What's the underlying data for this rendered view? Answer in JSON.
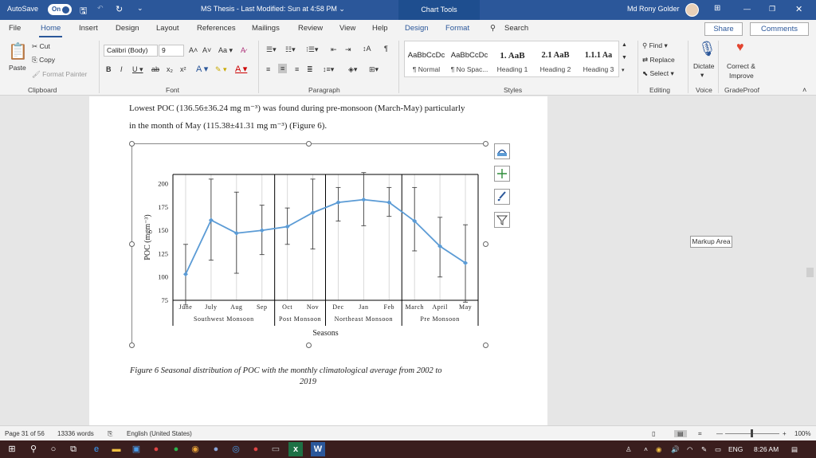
{
  "titlebar": {
    "autosave": "AutoSave",
    "autosave_state": "On",
    "doc_title": "MS Thesis  -  Last Modified: Sun at 4:58 PM  ⌄",
    "context_tab": "Chart Tools",
    "user": "Md Rony Golder",
    "min": "—",
    "restore": "❐",
    "close": "✕"
  },
  "menu": {
    "tabs": [
      "File",
      "Home",
      "Insert",
      "Design",
      "Layout",
      "References",
      "Mailings",
      "Review",
      "View",
      "Help"
    ],
    "context_tabs": [
      "Design",
      "Format"
    ],
    "search": "Search",
    "share": "Share",
    "comments": "Comments"
  },
  "ribbon": {
    "clipboard": {
      "paste": "Paste",
      "cut": "Cut",
      "copy": "Copy",
      "format_painter": "Format Painter",
      "label": "Clipboard"
    },
    "font": {
      "family": "Calibri (Body)",
      "size": "9",
      "label": "Font"
    },
    "paragraph": {
      "label": "Paragraph"
    },
    "styles": {
      "items": [
        {
          "preview": "AaBbCcDc",
          "name": "¶ Normal"
        },
        {
          "preview": "AaBbCcDc",
          "name": "¶ No Spac..."
        },
        {
          "preview": "1. AaB",
          "name": "Heading 1"
        },
        {
          "preview": "2.1 AaB",
          "name": "Heading 2"
        },
        {
          "preview": "1.1.1 Aa",
          "name": "Heading 3"
        }
      ],
      "label": "Styles"
    },
    "editing": {
      "find": "Find",
      "replace": "Replace",
      "select": "Select",
      "label": "Editing"
    },
    "voice": {
      "dictate": "Dictate",
      "label": "Voice"
    },
    "gradeproof": {
      "correct1": "Correct &",
      "correct2": "Improve",
      "label": "GradeProof"
    }
  },
  "document": {
    "line1": "Lowest POC (136.56±36.24 mg m⁻³) was found during pre-monsoon (March-May) particularly",
    "line2": "in the month of May (115.38±41.31 mg m⁻³) (Figure 6).",
    "caption1": "Figure 6 Seasonal distribution of POC with the monthly climatological average from 2002 to",
    "caption2": "2019",
    "markup_area": "Markup Area"
  },
  "chart_data": {
    "type": "line",
    "ylabel": "POC (mgm⁻³)",
    "xlabel": "Seasons",
    "ylim": [
      75,
      210
    ],
    "yticks": [
      75,
      100,
      125,
      150,
      175,
      200
    ],
    "categories": [
      "June",
      "July",
      "Aug",
      "Sep",
      "Oct",
      "Nov",
      "Dec",
      "Jan",
      "Feb",
      "March",
      "April",
      "May"
    ],
    "values": [
      103,
      161,
      147,
      150,
      154,
      169,
      180,
      183,
      180,
      160,
      133,
      115
    ],
    "error_low": [
      70,
      118,
      104,
      124,
      135,
      130,
      160,
      155,
      165,
      128,
      100,
      73
    ],
    "error_high": [
      135,
      205,
      191,
      177,
      174,
      205,
      196,
      212,
      196,
      196,
      164,
      156
    ],
    "season_groups": [
      {
        "name": "Southwest Monsoon",
        "span": 4
      },
      {
        "name": "Post Monsoon",
        "span": 2
      },
      {
        "name": "Northeast Monsoon",
        "span": 3
      },
      {
        "name": "Pre Monsoon",
        "span": 3
      }
    ],
    "color": "#5b9bd5",
    "grid": "vertical"
  },
  "statusbar": {
    "page": "Page 31 of 56",
    "words": "13336 words",
    "language": "English (United States)",
    "zoom": "100%"
  },
  "taskbar": {
    "lang": "ENG",
    "time": "8:26 AM"
  }
}
